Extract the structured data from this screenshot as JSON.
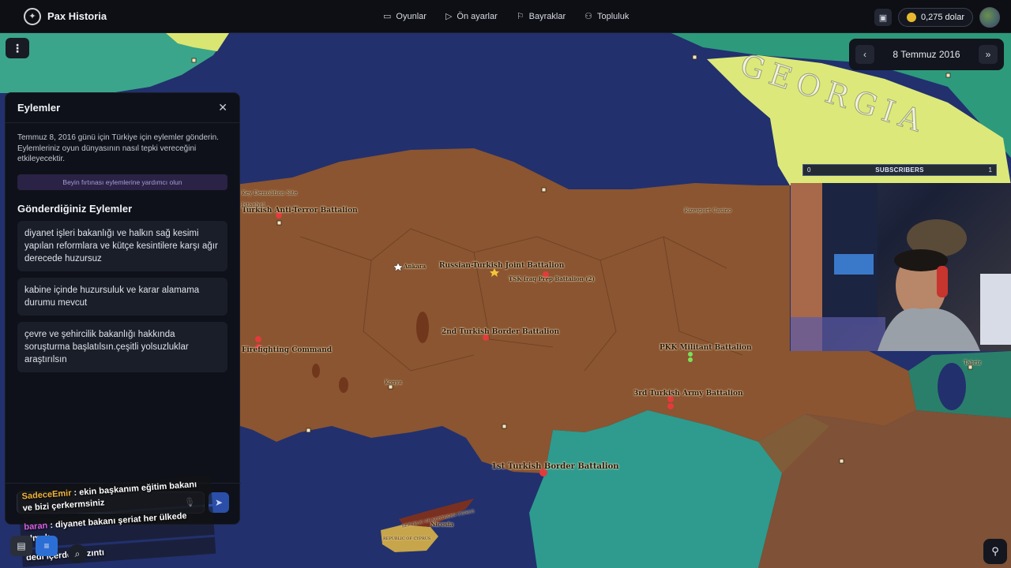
{
  "app": {
    "title": "Pax Historia",
    "logo_icon": "globe-icon"
  },
  "nav": {
    "items": [
      {
        "label": "Oyunlar",
        "icon": "gamepad-icon"
      },
      {
        "label": "Ön ayarlar",
        "icon": "play-icon"
      },
      {
        "label": "Bayraklar",
        "icon": "flag-icon"
      },
      {
        "label": "Topluluk",
        "icon": "users-icon"
      }
    ]
  },
  "wallet": {
    "balance": "0,275 dolar"
  },
  "date": {
    "current": "8 Temmuz 2016"
  },
  "panel": {
    "title": "Eylemler",
    "description": "Temmuz 8, 2016 günü için Türkiye için eylemler gönderin. Eylemleriniz oyun dünyasının nasıl tepki vereceğini etkileyecektir.",
    "brainstorm_label": "Beyin fırtınası eylemlerine yardımcı olun",
    "sent_title": "Gönderdiğiniz Eylemler",
    "actions": [
      "diyanet işleri bakanlığı ve halkın sağ kesimi yapılan reformlara ve kütçe kesintilere karşı ağır derecede huzursuz",
      "kabine içinde huzursuluk ve karar alamama durumu mevcut",
      "çevre ve şehircilik bakanlığı hakkında soruşturma başlatılsın.çeşitli yolsuzluklar araştırılsın"
    ]
  },
  "chat": {
    "messages": [
      {
        "user": "SadeceEmir",
        "text": ": ekin başkanım eğitim bakanı ve bizi çerkermsiniz"
      },
      {
        "user": "baran",
        "text": ": diyanet bakanı şeriat her ülkede olmalı"
      },
      {
        "user": "",
        "text": "dedi içerden sızıntı"
      }
    ]
  },
  "overlay": {
    "subscribers_label": "SUBSCRIBERS",
    "subscribers_left": "0",
    "subscribers_right": "1"
  },
  "map": {
    "country_labels": [
      "GEORGIA"
    ],
    "units": [
      "Russian-Turkish Joint Battalion",
      "TSK Iraq Prep Battalion (2)",
      "2nd Turkish Border Battalion",
      "PKK Militant Battalion",
      "3rd Turkish Army Battalion",
      "1st Turkish Border Battalion",
      "Turkish Anti-Terror Battalion",
      "Firefighting Command",
      "Key Demolition Site",
      "Rizesport Casino"
    ],
    "cities": [
      "Ankara",
      "Konya",
      "Nicosia",
      "Istanbul",
      "Tabriz"
    ],
    "cyprus_labels": [
      "REPUBLIC OF CYPRUS",
      "REPUBLIC OF NORTHERN CYPRUS"
    ],
    "colors": {
      "turkey": "#8a5530",
      "sea": "#22306e",
      "georgia": "#dce97a",
      "syria": "#2e9b8e",
      "iran": "#2a7f6a"
    }
  }
}
